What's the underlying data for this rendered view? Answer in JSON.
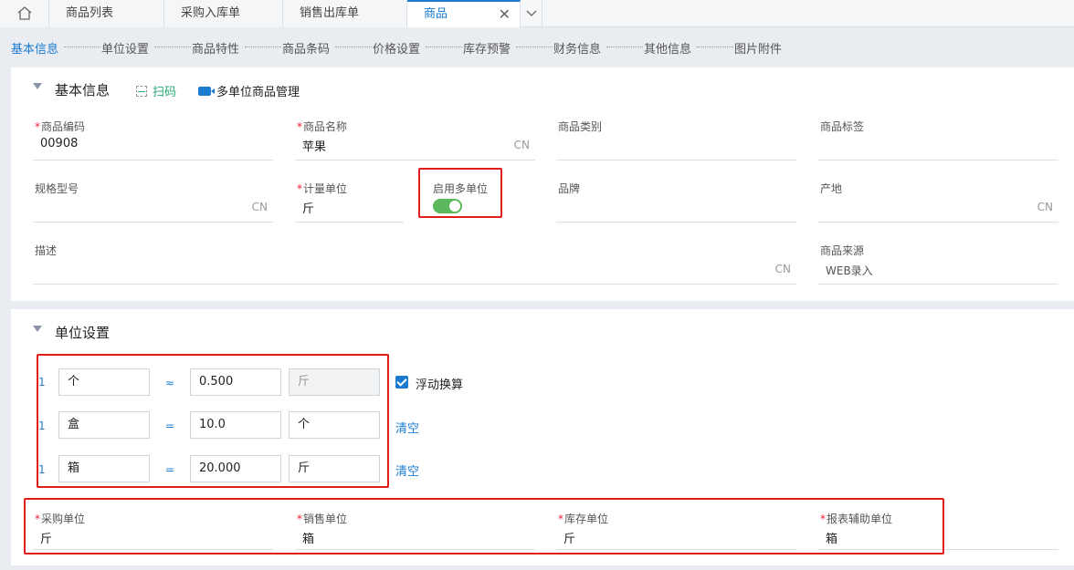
{
  "tabs": [
    {
      "label": "商品列表"
    },
    {
      "label": "采购入库单"
    },
    {
      "label": "销售出库单"
    },
    {
      "label": "商品"
    }
  ],
  "anchors": [
    "基本信息",
    "单位设置",
    "商品特性",
    "商品条码",
    "价格设置",
    "库存预警",
    "财务信息",
    "其他信息",
    "图片附件"
  ],
  "basic": {
    "title": "基本信息",
    "scan_label": "扫码",
    "multi_unit_label": "多单位商品管理",
    "fields": {
      "code": {
        "label": "商品编码",
        "value": "00908"
      },
      "name": {
        "label": "商品名称",
        "value": "苹果",
        "suffix": "CN"
      },
      "category": {
        "label": "商品类别",
        "value": ""
      },
      "tag": {
        "label": "商品标签",
        "value": ""
      },
      "spec": {
        "label": "规格型号",
        "value": "",
        "suffix": "CN"
      },
      "unit": {
        "label": "计量单位",
        "value": "斤"
      },
      "multi": {
        "label": "启用多单位",
        "enabled": true
      },
      "brand": {
        "label": "品牌",
        "value": ""
      },
      "origin": {
        "label": "产地",
        "value": "",
        "suffix": "CN"
      },
      "desc": {
        "label": "描述",
        "value": "",
        "suffix": "CN"
      },
      "source": {
        "label": "商品来源",
        "value": "WEB录入"
      }
    }
  },
  "units": {
    "title": "单位设置",
    "rows": [
      {
        "index": "1",
        "unit": "个",
        "op": "≈",
        "qty": "0.500",
        "base": "斤"
      },
      {
        "index": "1",
        "unit": "盒",
        "op": "=",
        "qty": "10.0",
        "base": "个"
      },
      {
        "index": "1",
        "unit": "箱",
        "op": "=",
        "qty": "20.000",
        "base": "斤"
      }
    ],
    "float_label": "浮动换算",
    "float_checked": true,
    "clear_label": "清空",
    "defaults": {
      "purchase": {
        "label": "采购单位",
        "value": "斤"
      },
      "sales": {
        "label": "销售单位",
        "value": "箱"
      },
      "stock": {
        "label": "库存单位",
        "value": "斤"
      },
      "report": {
        "label": "报表辅助单位",
        "value": "箱"
      }
    }
  }
}
